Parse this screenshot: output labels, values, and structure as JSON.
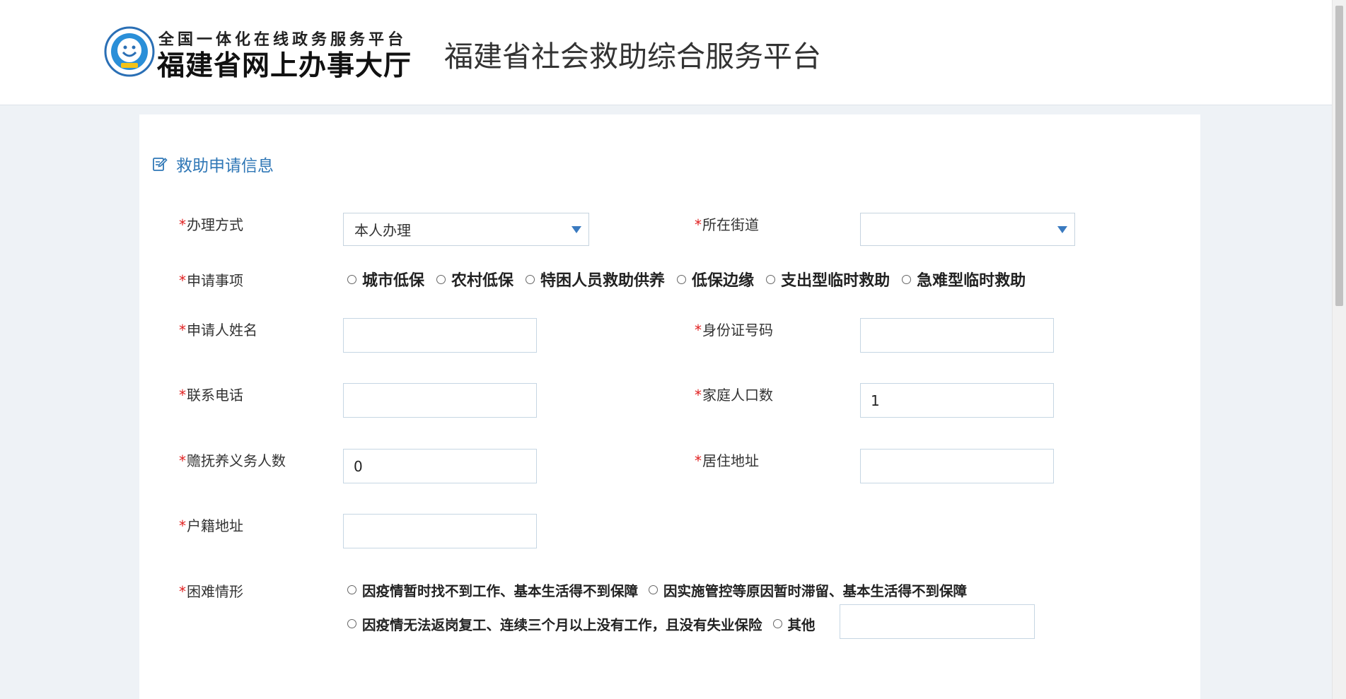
{
  "header": {
    "logo_top": "全国一体化在线政务服务平台",
    "logo_main": "福建省网上办事大厅",
    "title": "福建省社会救助综合服务平台"
  },
  "section": {
    "title": "救助申请信息"
  },
  "form": {
    "required_mark": "*",
    "handle_method": {
      "label": "办理方式",
      "value": "本人办理"
    },
    "street": {
      "label": "所在街道",
      "value": ""
    },
    "apply_items": {
      "label": "申请事项",
      "options": [
        "城市低保",
        "农村低保",
        "特困人员救助供养",
        "低保边缘",
        "支出型临时救助",
        "急难型临时救助"
      ]
    },
    "applicant_name": {
      "label": "申请人姓名",
      "value": ""
    },
    "id_number": {
      "label": "身份证号码",
      "value": ""
    },
    "phone": {
      "label": "联系电话",
      "value": ""
    },
    "household_size": {
      "label": "家庭人口数",
      "value": "1"
    },
    "support_count": {
      "label": "赡抚养义务人数",
      "value": "0"
    },
    "address": {
      "label": "居住地址",
      "value": ""
    },
    "registered_address": {
      "label": "户籍地址",
      "value": ""
    },
    "difficulty": {
      "label": "困难情形",
      "options": [
        "因疫情暂时找不到工作、基本生活得不到保障",
        "因实施管控等原因暂时滞留、基本生活得不到保障",
        "因疫情无法返岗复工、连续三个月以上没有工作，且没有失业保险",
        "其他"
      ],
      "other_value": ""
    }
  },
  "colors": {
    "accent": "#2f77b6",
    "required": "#e02020",
    "border": "#c6d6e3"
  }
}
